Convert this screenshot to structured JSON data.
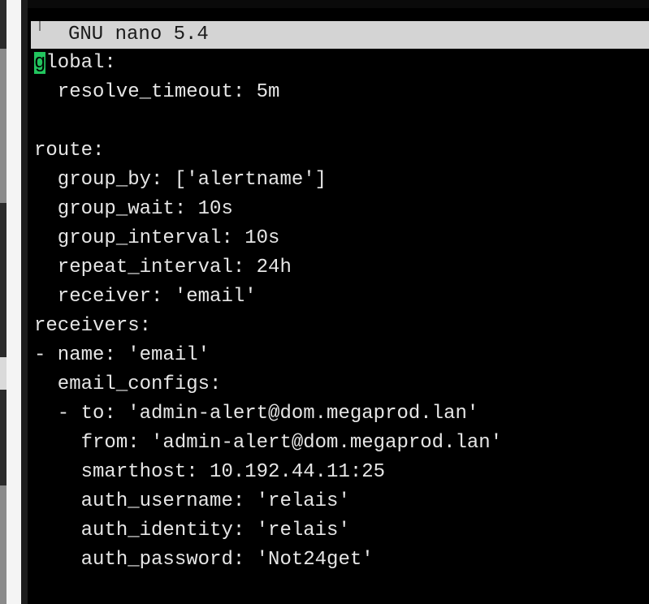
{
  "app": {
    "title_bar": "GNU nano 5.4"
  },
  "buffer": {
    "cursor_char": "g",
    "lines": [
      "lobal:",
      "  resolve_timeout: 5m",
      "",
      "route:",
      "  group_by: ['alertname']",
      "  group_wait: 10s",
      "  group_interval: 10s",
      "  repeat_interval: 24h",
      "  receiver: 'email'",
      "receivers:",
      "- name: 'email'",
      "  email_configs:",
      "  - to: 'admin-alert@dom.megaprod.lan'",
      "    from: 'admin-alert@dom.megaprod.lan'",
      "    smarthost: 10.192.44.11:25",
      "    auth_username: 'relais'",
      "    auth_identity: 'relais'",
      "    auth_password: 'Not24get'"
    ]
  },
  "colors": {
    "terminal_bg": "#000000",
    "text": "#e6e6e6",
    "titlebar_bg": "#d4d4d4",
    "cursor": "#22c55e"
  }
}
